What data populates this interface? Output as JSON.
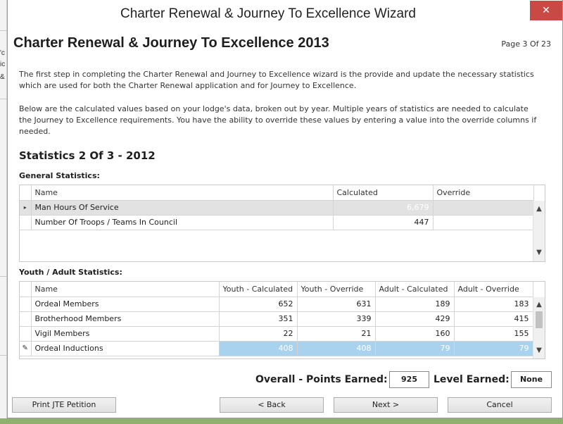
{
  "window": {
    "title": "Charter Renewal & Journey To Excellence Wizard",
    "close_glyph": "✕"
  },
  "background_app": {
    "fragments": [
      "'c",
      "ic",
      "&"
    ]
  },
  "page": {
    "title": "Charter Renewal & Journey To Excellence 2013",
    "indicator": "Page 3 Of 23",
    "intro_1": "The first step in completing the Charter Renewal and Journey to Excellence wizard is the provide and update the necessary statistics which are used for both the Charter Renewal application and for Journey to Excellence.",
    "intro_2": "Below are the calculated values based on your lodge's data, broken out by year. Multiple years of statistics are needed to calculate the Journey to Excellence requirements. You have the ability to override these values by entering a value into the override columns if needed.",
    "section_title": "Statistics 2 Of 3 - 2012"
  },
  "general": {
    "label": "General Statistics:",
    "columns": [
      "Name",
      "Calculated",
      "Override"
    ],
    "rows": [
      {
        "name": "Man Hours Of Service",
        "calculated": "6,679",
        "override": ""
      },
      {
        "name": "Number Of Troops / Teams In Council",
        "calculated": "447",
        "override": ""
      }
    ],
    "current_row_glyph": "▸"
  },
  "youth_adult": {
    "label": "Youth / Adult Statistics:",
    "columns": [
      "Name",
      "Youth - Calculated",
      "Youth - Override",
      "Adult - Calculated",
      "Adult - Override"
    ],
    "rows": [
      {
        "name": "Ordeal Members",
        "yc": "652",
        "yo": "631",
        "ac": "189",
        "ao": "183"
      },
      {
        "name": "Brotherhood Members",
        "yc": "351",
        "yo": "339",
        "ac": "429",
        "ao": "415"
      },
      {
        "name": "Vigil Members",
        "yc": "22",
        "yo": "21",
        "ac": "160",
        "ao": "155"
      },
      {
        "name": "Ordeal Inductions",
        "yc": "408",
        "yo": "408",
        "ac": "79",
        "ao": "79"
      }
    ],
    "edit_row_glyph": "✎"
  },
  "summary": {
    "points_label": "Overall - Points Earned:",
    "points_value": "925",
    "level_label": "Level Earned:",
    "level_value": "None"
  },
  "buttons": {
    "print": "Print JTE Petition",
    "back": "< Back",
    "next": "Next >",
    "cancel": "Cancel"
  },
  "icons": {
    "scroll_up": "up-arrow-icon",
    "scroll_down": "down-arrow-icon"
  },
  "colors": {
    "close_button": "#c94a44",
    "selected_cell": "#a9d2ee",
    "readonly_row": "#e2e2e2"
  }
}
